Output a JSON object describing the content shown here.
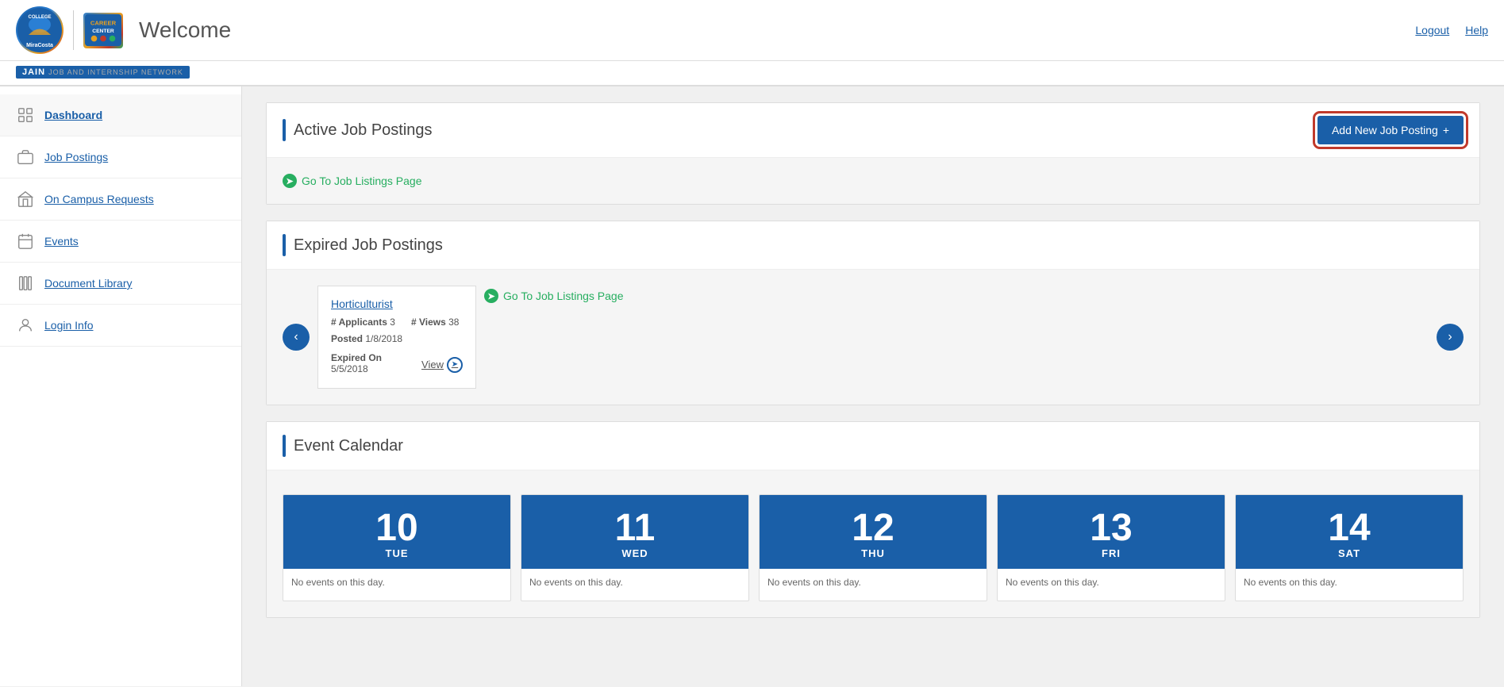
{
  "header": {
    "welcome": "Welcome",
    "logout": "Logout",
    "help": "Help"
  },
  "jain": {
    "letters": "JAIN",
    "subtitle": "Job and Internship Network"
  },
  "sidebar": {
    "items": [
      {
        "id": "dashboard",
        "label": "Dashboard",
        "icon": "grid"
      },
      {
        "id": "job-postings",
        "label": "Job Postings",
        "icon": "briefcase"
      },
      {
        "id": "on-campus-requests",
        "label": "On Campus Requests",
        "icon": "building"
      },
      {
        "id": "events",
        "label": "Events",
        "icon": "calendar"
      },
      {
        "id": "document-library",
        "label": "Document Library",
        "icon": "library"
      },
      {
        "id": "login-info",
        "label": "Login Info",
        "icon": "person"
      }
    ]
  },
  "active_postings": {
    "title": "Active Job Postings",
    "add_button": "Add New Job Posting",
    "go_to_link": "Go To Job Listings Page"
  },
  "expired_postings": {
    "title": "Expired Job Postings",
    "go_to_link": "Go To Job Listings Page",
    "jobs": [
      {
        "title": "Horticulturist",
        "applicants_label": "# Applicants",
        "applicants_count": "3",
        "views_label": "# Views",
        "views_count": "38",
        "posted_label": "Posted",
        "posted_date": "1/8/2018",
        "expired_label": "Expired On",
        "expired_date": "5/5/2018",
        "view_label": "View"
      }
    ]
  },
  "event_calendar": {
    "title": "Event Calendar",
    "days": [
      {
        "num": "10",
        "name": "TUE",
        "events": "No events on this day."
      },
      {
        "num": "11",
        "name": "WED",
        "events": "No events on this day."
      },
      {
        "num": "12",
        "name": "THU",
        "events": "No events on this day."
      },
      {
        "num": "13",
        "name": "FRI",
        "events": "No events on this day."
      },
      {
        "num": "14",
        "name": "SAT",
        "events": "No events on this day."
      }
    ]
  }
}
